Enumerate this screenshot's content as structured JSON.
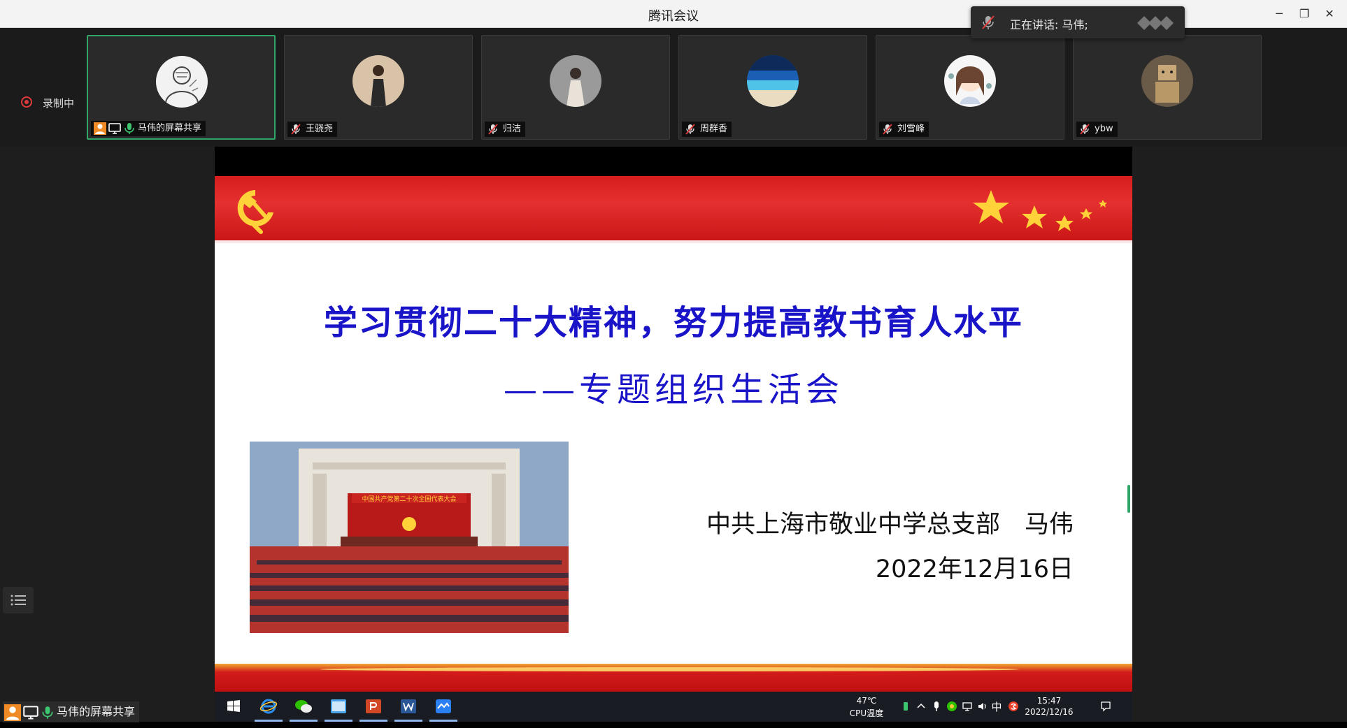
{
  "window": {
    "title": "腾讯会议",
    "controls": {
      "minimize": "─",
      "restore": "❐",
      "close": "✕"
    }
  },
  "speaking": {
    "label": "正在讲话: 马伟;"
  },
  "recording": {
    "label": "录制中"
  },
  "participants": [
    {
      "name": "马伟的屏幕共享",
      "active": true
    },
    {
      "name": "王骁尧"
    },
    {
      "name": "归洁"
    },
    {
      "name": "周群香"
    },
    {
      "name": "刘雪峰"
    },
    {
      "name": "ybw"
    }
  ],
  "slide": {
    "title": "学习贯彻二十大精神，努力提高教书育人水平",
    "subtitle": "——专题组织生活会",
    "photo_banner": "中国共产党第二十次全国代表大会",
    "organization": "中共上海市敬业中学总支部　马伟",
    "date": "2022年12月16日"
  },
  "taskbar": {
    "temperature": "47℃",
    "temperature_label": "CPU温度",
    "ime": "中",
    "time": "15:47",
    "date": "2022/12/16"
  },
  "share_label": "马伟的屏幕共享",
  "colors": {
    "active_border": "#2fa667",
    "slide_title": "#1a14c9",
    "banner_red": "#d71d1d",
    "recording_red": "#e03a3a"
  }
}
